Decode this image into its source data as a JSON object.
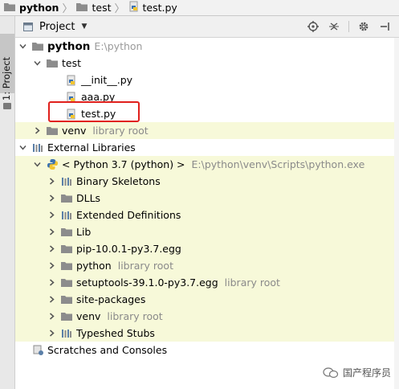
{
  "breadcrumb": {
    "items": [
      {
        "label": "python",
        "icon": "folder-icon",
        "bold": true
      },
      {
        "label": "test",
        "icon": "folder-icon",
        "bold": false
      },
      {
        "label": "test.py",
        "icon": "python-file-icon",
        "bold": false
      }
    ]
  },
  "side_strip": {
    "tab_label": "1: Project"
  },
  "panel_header": {
    "title": "Project",
    "dropdown_icon": "chevron-down-icon",
    "tools": [
      "target-icon",
      "collapse-icon",
      "gear-icon",
      "hide-icon"
    ]
  },
  "tree": {
    "root": {
      "label": "python",
      "path": "E:\\python"
    },
    "test_folder": {
      "label": "test"
    },
    "files": [
      {
        "label": "__init__.py"
      },
      {
        "label": "aaa.py"
      },
      {
        "label": "test.py"
      }
    ],
    "venv_root": {
      "label": "venv",
      "note": "library root"
    },
    "external_libraries": {
      "label": "External Libraries"
    },
    "sdk": {
      "label": "< Python 3.7 (python) >",
      "path": "E:\\python\\venv\\Scripts\\python.exe"
    },
    "sdk_children": [
      {
        "label": "Binary Skeletons",
        "note": "",
        "icon": "library-icon"
      },
      {
        "label": "DLLs",
        "note": "",
        "icon": "folder-icon"
      },
      {
        "label": "Extended Definitions",
        "note": "",
        "icon": "library-icon"
      },
      {
        "label": "Lib",
        "note": "",
        "icon": "folder-icon"
      },
      {
        "label": "pip-10.0.1-py3.7.egg",
        "note": "",
        "icon": "folder-icon"
      },
      {
        "label": "python",
        "note": "library root",
        "icon": "folder-icon"
      },
      {
        "label": "setuptools-39.1.0-py3.7.egg",
        "note": "library root",
        "icon": "folder-icon"
      },
      {
        "label": "site-packages",
        "note": "",
        "icon": "folder-icon"
      },
      {
        "label": "venv",
        "note": "library root",
        "icon": "folder-icon"
      },
      {
        "label": "Typeshed Stubs",
        "note": "",
        "icon": "library-icon"
      }
    ],
    "scratches": {
      "label": "Scratches and Consoles"
    }
  },
  "watermark": {
    "text": "国产程序员"
  },
  "colors": {
    "highlight_row": "#f7f9d9",
    "selection_box": "#e0201c",
    "folder": "#8c8c8c",
    "python_blue": "#3a72b0",
    "python_yellow": "#f2c530"
  }
}
